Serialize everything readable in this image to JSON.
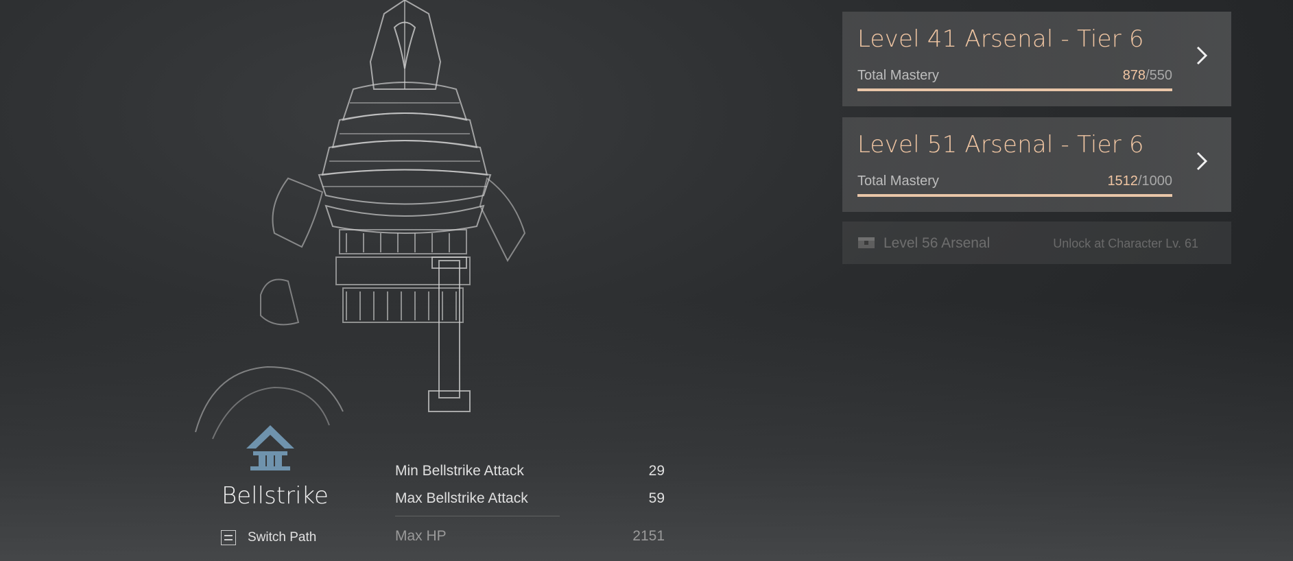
{
  "arsenals": [
    {
      "title": "Level 41 Arsenal - Tier 6",
      "mastery_label": "Total Mastery",
      "mastery_current": "878",
      "mastery_required": "/550",
      "progress": 1.0
    },
    {
      "title": "Level 51 Arsenal - Tier 6",
      "mastery_label": "Total Mastery",
      "mastery_current": "1512",
      "mastery_required": "/1000",
      "progress": 1.0
    }
  ],
  "locked_arsenal": {
    "label": "Level 56 Arsenal",
    "requirement": "Unlock at Character Lv. 61"
  },
  "path": {
    "name": "Bellstrike",
    "switch_label": "Switch Path"
  },
  "stats": [
    {
      "name": "Min Bellstrike Attack",
      "value": "29"
    },
    {
      "name": "Max Bellstrike Attack",
      "value": "59"
    },
    {
      "name": "Max HP",
      "value": "2151"
    }
  ],
  "colors": {
    "accent": "#f1c6a3",
    "emblem": "#6f93ad"
  },
  "icons": {
    "card_arrow": "chevron-right-icon",
    "locked": "chest-icon",
    "path": "bellstrike-emblem-icon",
    "switch": "switch-path-icon"
  }
}
